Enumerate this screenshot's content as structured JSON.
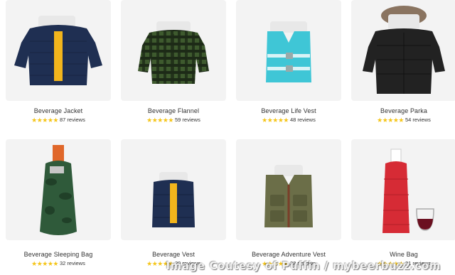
{
  "products": [
    {
      "name": "Beverage Jacket",
      "stars": "★★★★★",
      "reviews": "87 reviews"
    },
    {
      "name": "Beverage Flannel",
      "stars": "★★★★★",
      "reviews": "59 reviews"
    },
    {
      "name": "Beverage Life Vest",
      "stars": "★★★★★",
      "reviews": "48 reviews"
    },
    {
      "name": "Beverage Parka",
      "stars": "★★★★★",
      "reviews": "54 reviews"
    },
    {
      "name": "Beverage Sleeping Bag",
      "stars": "★★★★★",
      "reviews": "32 reviews"
    },
    {
      "name": "Beverage Vest",
      "stars": "★★★★★",
      "reviews": "29 reviews"
    },
    {
      "name": "Beverage Adventure Vest",
      "stars": "★★★★★",
      "reviews": "28 reviews"
    },
    {
      "name": "Wine Bag",
      "stars": "★★★★★",
      "reviews": "31 reviews"
    }
  ],
  "watermark": "Image Coutesy of Puffin / mybeerbuzz.com",
  "colors": {
    "star": "#f5c518",
    "card_bg": "#f3f3f3",
    "jacket_navy": "#1f2f52",
    "zipper_yellow": "#f2b51c",
    "flannel_green": "#3e5a2e",
    "lifevest_cyan": "#3fc6d6",
    "parka_black": "#222222",
    "sleepingbag_camo": "#2f5a3a",
    "adventure_olive": "#6b6e48",
    "wine_red": "#d62b35"
  }
}
